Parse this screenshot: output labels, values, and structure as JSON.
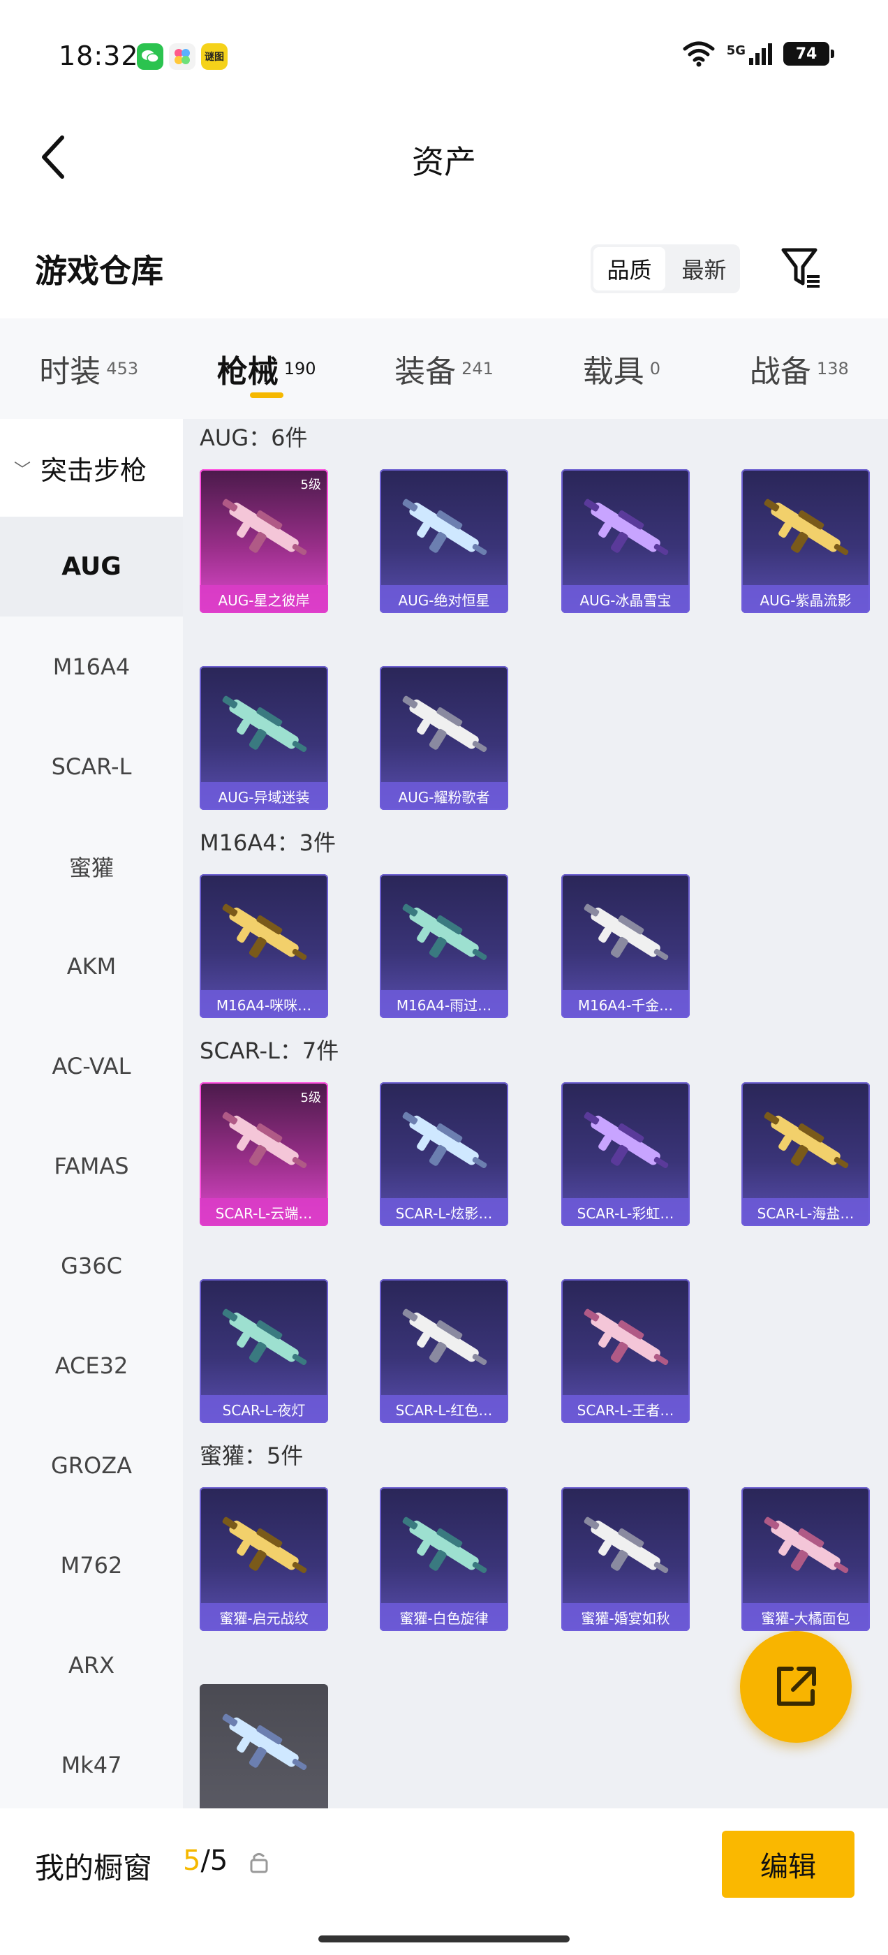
{
  "status_bar": {
    "time": "18:32",
    "apps": [
      {
        "icon": "wechat-icon",
        "color": "#2bc34f"
      },
      {
        "icon": "colorful-app-icon",
        "color": "#f3f3f3"
      },
      {
        "icon": "game-app-icon",
        "color": "#f5d21a",
        "label": "谜图"
      }
    ],
    "network": "5G",
    "battery": "74"
  },
  "header": {
    "title": "资产"
  },
  "warehouse": {
    "title": "游戏仓库",
    "sort_options": [
      "品质",
      "最新"
    ],
    "sort_selected": "品质"
  },
  "tabs": [
    {
      "label": "时装",
      "count": "453"
    },
    {
      "label": "枪械",
      "count": "190",
      "active": true
    },
    {
      "label": "装备",
      "count": "241"
    },
    {
      "label": "载具",
      "count": "0"
    },
    {
      "label": "战备",
      "count": "138"
    }
  ],
  "sidebar": {
    "category": "突击步枪",
    "items": [
      "AUG",
      "M16A4",
      "SCAR-L",
      "蜜獾",
      "AKM",
      "AC-VAL",
      "FAMAS",
      "G36C",
      "ACE32",
      "GROZA",
      "M762",
      "ARX",
      "Mk47"
    ],
    "active": "AUG"
  },
  "groups": [
    {
      "title": "AUG：6件",
      "items": [
        {
          "name": "AUG-星之彼岸",
          "level": "5级",
          "style": "pink"
        },
        {
          "name": "AUG-绝对恒星",
          "style": "blue"
        },
        {
          "name": "AUG-冰晶雪宝",
          "style": "blue"
        },
        {
          "name": "AUG-紫晶流影",
          "style": "blue"
        },
        {
          "name": "AUG-异域迷装",
          "style": "blue"
        },
        {
          "name": "AUG-耀粉歌者",
          "style": "blue"
        }
      ]
    },
    {
      "title": "M16A4：3件",
      "items": [
        {
          "name": "M16A4-咪咪…",
          "style": "blue"
        },
        {
          "name": "M16A4-雨过…",
          "style": "blue"
        },
        {
          "name": "M16A4-千金…",
          "style": "blue"
        }
      ]
    },
    {
      "title": "SCAR-L：7件",
      "items": [
        {
          "name": "SCAR-L-云端…",
          "level": "5级",
          "style": "pink"
        },
        {
          "name": "SCAR-L-炫影…",
          "style": "blue"
        },
        {
          "name": "SCAR-L-彩虹…",
          "style": "blue"
        },
        {
          "name": "SCAR-L-海盐…",
          "style": "blue"
        },
        {
          "name": "SCAR-L-夜灯",
          "style": "blue"
        },
        {
          "name": "SCAR-L-红色…",
          "style": "blue"
        },
        {
          "name": "SCAR-L-王者…",
          "style": "blue"
        }
      ]
    },
    {
      "title": "蜜獾：5件",
      "items": [
        {
          "name": "蜜獾-启元战纹",
          "style": "blue"
        },
        {
          "name": "蜜獾-白色旋律",
          "style": "blue"
        },
        {
          "name": "蜜獾-婚宴如秋",
          "style": "blue"
        },
        {
          "name": "蜜獾-大橘面包",
          "style": "blue"
        },
        {
          "name": "",
          "style": "gray"
        }
      ]
    }
  ],
  "bottom": {
    "label": "我的橱窗",
    "current": "5",
    "total": "/5",
    "edit_label": "编辑"
  },
  "colors": {
    "accent": "#f5b800",
    "card_blue": "#3a3478",
    "card_pink": "#e04ad0"
  }
}
